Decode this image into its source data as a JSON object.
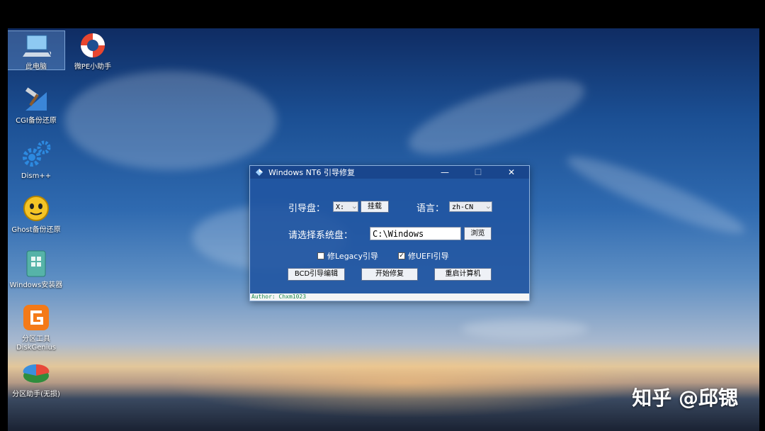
{
  "desktop": {
    "icons": [
      {
        "label": "此电脑"
      },
      {
        "label": "微PE小助手"
      },
      {
        "label": "CGI备份还原"
      },
      {
        "label": "Dism++"
      },
      {
        "label": "Ghost备份还原"
      },
      {
        "label": "Windows安装器"
      },
      {
        "label": "分区工具DiskGenius"
      },
      {
        "label": "分区助手(无损)"
      }
    ]
  },
  "window": {
    "title": "Windows NT6 引导修复",
    "minimize": "—",
    "maximize": "☐",
    "close": "✕",
    "boot_disk_label": "引导盘：",
    "boot_disk_value": "X:",
    "mount_button": "挂载",
    "language_label": "语言：",
    "language_value": "zh-CN",
    "system_disk_label": "请选择系统盘：",
    "system_disk_value": "C:\\Windows",
    "browse_button": "浏览",
    "legacy_checkbox": "修Legacy引导",
    "legacy_checked": false,
    "uefi_checkbox": "修UEFI引导",
    "uefi_checked": true,
    "bcd_button": "BCD引导编辑",
    "start_button": "开始修复",
    "restart_button": "重启计算机",
    "status": "Author: Chxm1023"
  },
  "watermark": "知乎 @邱锶",
  "colors": {
    "window_bg": "#2054a0",
    "status_text": "#1a8a4a"
  }
}
